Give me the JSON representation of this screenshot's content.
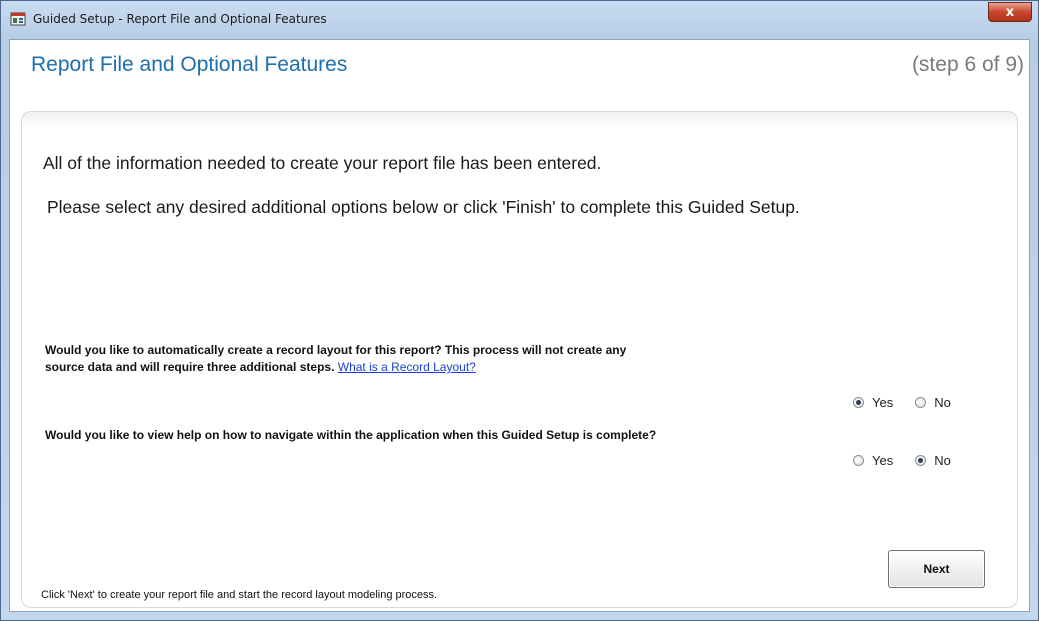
{
  "window": {
    "title": "Guided Setup - Report File and Optional Features",
    "close_icon": "close-icon",
    "close_glyph": "x"
  },
  "header": {
    "title": "Report File and Optional Features",
    "step": "(step 6 of 9)"
  },
  "info": {
    "line1": "All of the information needed to create your report file has been entered.",
    "line2": "Please select any desired additional options below or click 'Finish' to complete this Guided Setup."
  },
  "questions": [
    {
      "text_line1": "Would you like to automatically create a record layout for this report?  This process will not create any",
      "text_line2": "source data and will require three additional steps.",
      "link": "What is a Record Layout?",
      "options": [
        "Yes",
        "No"
      ],
      "selected": "Yes"
    },
    {
      "text": "Would you like to view help on how to navigate within the application when this Guided Setup is complete?",
      "options": [
        "Yes",
        "No"
      ],
      "selected": "No"
    }
  ],
  "footer": {
    "hint": "Click 'Next' to create your report file and start the record layout modeling process.",
    "next_label": "Next"
  },
  "colors": {
    "title_blue": "#1b6fae",
    "link_blue": "#1a3fd6",
    "close_red": "#c7462c"
  }
}
